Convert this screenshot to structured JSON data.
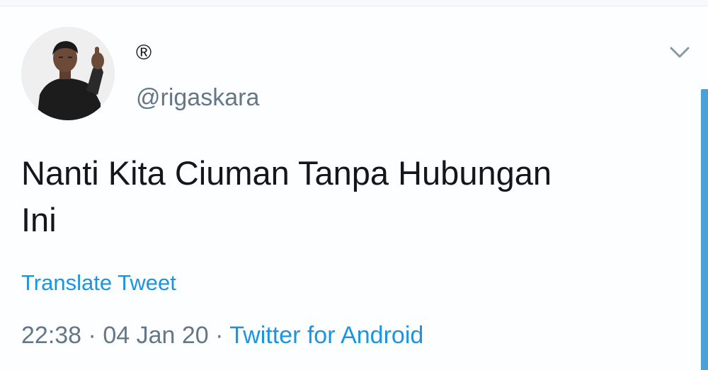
{
  "tweet": {
    "display_name": "®",
    "handle": "@rigaskara",
    "text_line1": "Nanti Kita Ciuman Tanpa Hubungan",
    "text_line2": "Ini",
    "translate_label": "Translate Tweet",
    "time": "22:38",
    "separator": " · ",
    "date": "04 Jan 20",
    "source": "Twitter for Android"
  },
  "icons": {
    "avatar": "profile-photo",
    "menu": "chevron-down-icon"
  },
  "colors": {
    "link": "#1b95e0",
    "secondary_text": "#657786",
    "primary_text": "#14171a",
    "scrollbar": "#4aa1d8"
  }
}
